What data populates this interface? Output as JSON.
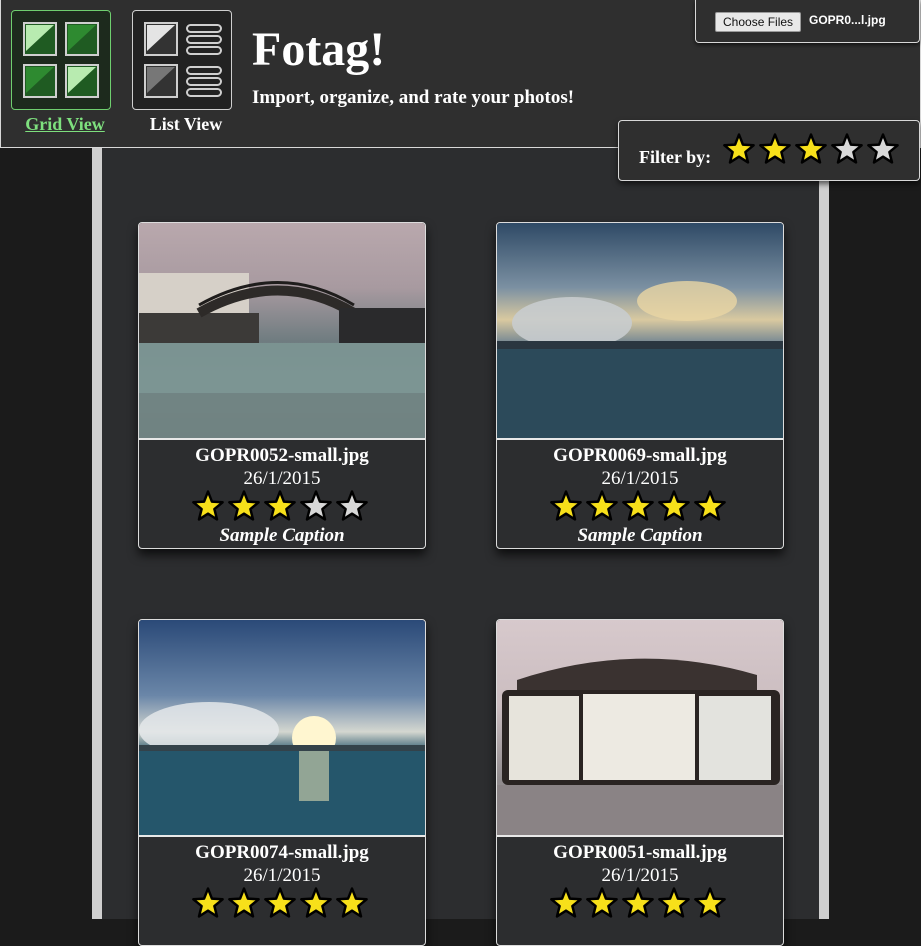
{
  "header": {
    "title": "Fotag!",
    "subtitle": "Import, organize, and rate your photos!",
    "grid_view_label": "Grid View",
    "list_view_label": "List View",
    "active_view": "grid",
    "file_button_label": "Choose Files",
    "file_name": "GOPR0...l.jpg"
  },
  "filter": {
    "label": "Filter by:",
    "rating": 3,
    "max": 5
  },
  "photos": [
    {
      "filename": "GOPR0052-small.jpg",
      "date": "26/1/2015",
      "rating": 3,
      "caption": "Sample Caption",
      "scene": "bridge"
    },
    {
      "filename": "GOPR0069-small.jpg",
      "date": "26/1/2015",
      "rating": 5,
      "caption": "Sample Caption",
      "scene": "clouds"
    },
    {
      "filename": "GOPR0074-small.jpg",
      "date": "26/1/2015",
      "rating": 5,
      "caption": "",
      "scene": "sunset"
    },
    {
      "filename": "GOPR0051-small.jpg",
      "date": "26/1/2015",
      "rating": 5,
      "caption": "",
      "scene": "signboard"
    }
  ],
  "colors": {
    "star_on": "#f7e01a",
    "star_off": "#d8d8d8",
    "active_green": "#7ee07e",
    "panel": "#2f2f2f"
  }
}
